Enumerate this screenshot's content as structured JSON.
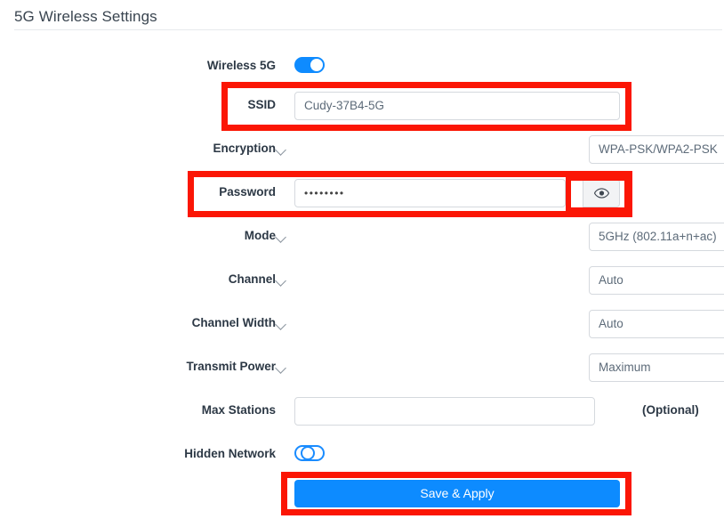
{
  "page": {
    "title": "5G Wireless Settings"
  },
  "form": {
    "rows": [
      {
        "label": "Wireless 5G",
        "type": "toggle",
        "state": "on"
      },
      {
        "label": "SSID",
        "type": "text",
        "value": "Cudy-37B4-5G"
      },
      {
        "label": "Encryption",
        "type": "select",
        "value": "WPA-PSK/WPA2-PSK"
      },
      {
        "label": "Password",
        "type": "password",
        "value": "••••••••",
        "reveal_icon": "eye-icon"
      },
      {
        "label": "Mode",
        "type": "select",
        "value": "5GHz (802.11a+n+ac)"
      },
      {
        "label": "Channel",
        "type": "select",
        "value": "Auto"
      },
      {
        "label": "Channel Width",
        "type": "select",
        "value": "Auto"
      },
      {
        "label": "Transmit Power",
        "type": "select",
        "value": "Maximum"
      },
      {
        "label": "Max Stations",
        "type": "text",
        "value": "",
        "suffix": "(Optional)"
      },
      {
        "label": "Hidden Network",
        "type": "toggle",
        "state": "off"
      }
    ]
  },
  "actions": {
    "save_label": "Save & Apply"
  },
  "colors": {
    "accent": "#0d8bff",
    "annotation": "#fb1605",
    "label_text": "#2c3845",
    "field_text": "#5d6b79",
    "field_border": "#d5d9de"
  }
}
